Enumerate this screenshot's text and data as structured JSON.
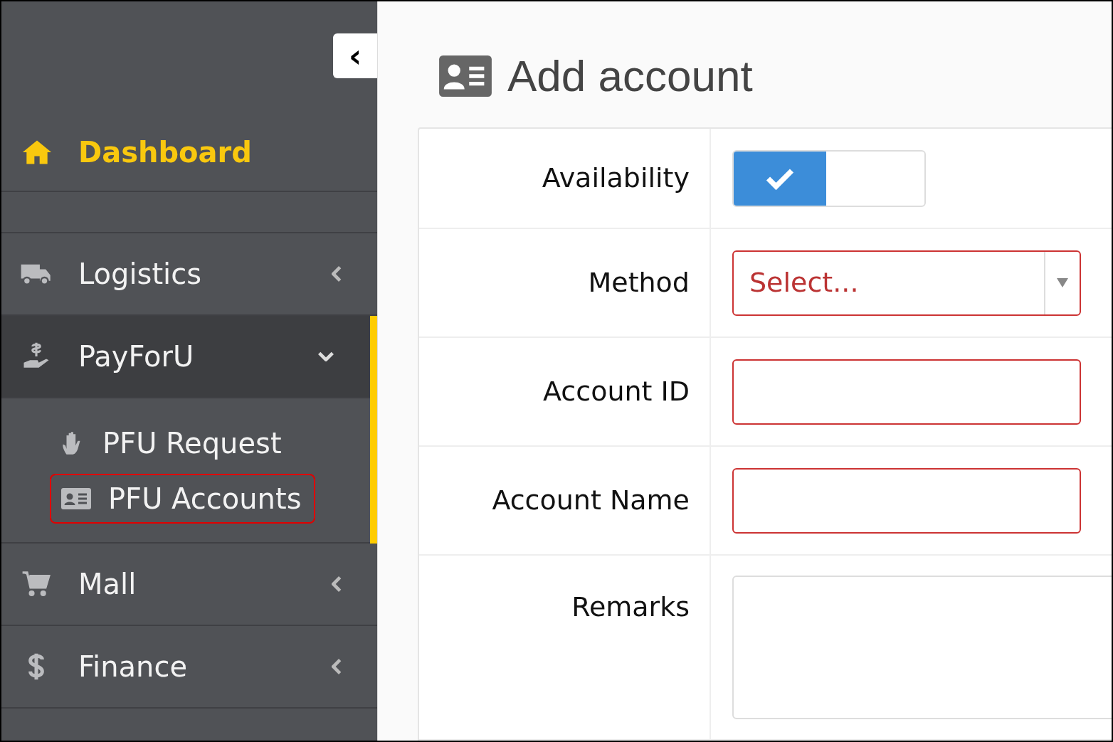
{
  "sidebar": {
    "collapse_button": "‹",
    "items": [
      {
        "kind": "home",
        "label": "Dashboard",
        "active": true
      },
      {
        "kind": "spacer"
      },
      {
        "kind": "menu",
        "label": "Logistics",
        "expanded": false
      },
      {
        "kind": "menu",
        "label": "PayForU",
        "expanded": true,
        "children": [
          {
            "label": "PFU Request",
            "selected": false
          },
          {
            "label": "PFU Accounts",
            "selected": true
          }
        ]
      },
      {
        "kind": "menu",
        "label": "Mall",
        "expanded": false
      },
      {
        "kind": "menu",
        "label": "Finance",
        "expanded": false
      }
    ]
  },
  "page": {
    "title": "Add account",
    "form": [
      {
        "kind": "toggle",
        "label": "Availability",
        "on": true
      },
      {
        "kind": "select",
        "label": "Method",
        "placeholder": "Select...",
        "invalid": true
      },
      {
        "kind": "text",
        "label": "Account ID",
        "invalid": true
      },
      {
        "kind": "text",
        "label": "Account Name",
        "invalid": true
      },
      {
        "kind": "textarea",
        "label": "Remarks",
        "invalid": false
      }
    ]
  }
}
